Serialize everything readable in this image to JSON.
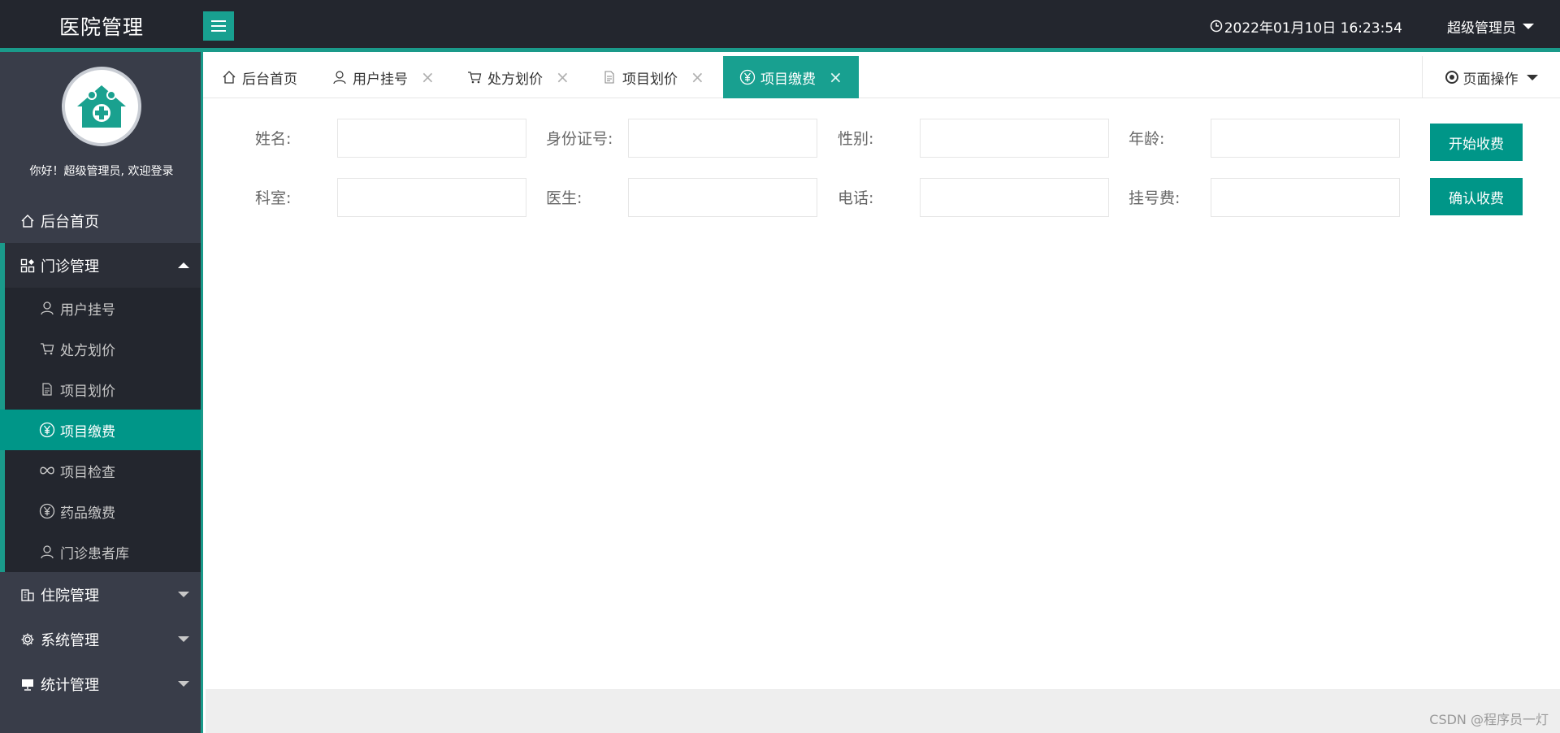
{
  "header": {
    "brand": "医院管理",
    "clock": "2022年01月10日 16:23:54",
    "user": "超级管理员"
  },
  "sidebar": {
    "welcome": "你好！超级管理员, 欢迎登录",
    "items": [
      {
        "label": "后台首页",
        "icon": "home-icon"
      },
      {
        "label": "门诊管理",
        "icon": "grid-icon",
        "open": true,
        "children": [
          {
            "label": "用户挂号",
            "icon": "user-icon"
          },
          {
            "label": "处方划价",
            "icon": "cart-icon"
          },
          {
            "label": "项目划价",
            "icon": "document-icon"
          },
          {
            "label": "项目缴费",
            "icon": "yen-icon",
            "active": true
          },
          {
            "label": "项目检查",
            "icon": "infinity-icon"
          },
          {
            "label": "药品缴费",
            "icon": "yen-icon"
          },
          {
            "label": "门诊患者库",
            "icon": "user-icon"
          }
        ]
      },
      {
        "label": "住院管理",
        "icon": "building-icon"
      },
      {
        "label": "系统管理",
        "icon": "gear-icon"
      },
      {
        "label": "统计管理",
        "icon": "monitor-icon"
      }
    ]
  },
  "tabs": [
    {
      "label": "后台首页",
      "icon": "home-icon"
    },
    {
      "label": "用户挂号",
      "icon": "user-icon"
    },
    {
      "label": "处方划价",
      "icon": "cart-icon"
    },
    {
      "label": "项目划价",
      "icon": "document-icon"
    },
    {
      "label": "项目缴费",
      "icon": "yen-icon",
      "active": true
    }
  ],
  "page_ops": "页面操作",
  "form": {
    "row1": [
      {
        "label": "姓名:",
        "value": ""
      },
      {
        "label": "身份证号:",
        "value": ""
      },
      {
        "label": "性别:",
        "value": ""
      },
      {
        "label": "年龄:",
        "value": ""
      }
    ],
    "row2": [
      {
        "label": "科室:",
        "value": ""
      },
      {
        "label": "医生:",
        "value": ""
      },
      {
        "label": "电话:",
        "value": ""
      },
      {
        "label": "挂号费:",
        "value": ""
      }
    ],
    "start_button": "开始收费",
    "confirm_button": "确认收费"
  },
  "watermark": "CSDN @程序员一灯",
  "colors": {
    "accent": "#009688",
    "header_bg": "#23262e",
    "sidebar_bg": "#393d49"
  }
}
